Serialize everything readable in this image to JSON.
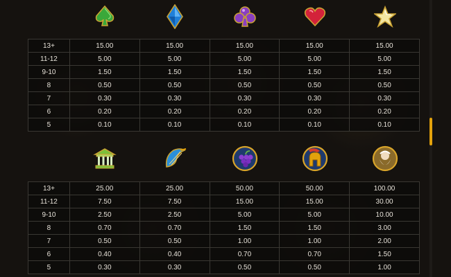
{
  "paytable": {
    "top": {
      "symbols": [
        "green-spade-gem",
        "blue-diamond-gem",
        "purple-club-gem",
        "red-heart-gem",
        "yellow-star-gem"
      ],
      "rows": [
        {
          "count": "13+",
          "values": [
            "15.00",
            "15.00",
            "15.00",
            "15.00",
            "15.00"
          ]
        },
        {
          "count": "11-12",
          "values": [
            "5.00",
            "5.00",
            "5.00",
            "5.00",
            "5.00"
          ]
        },
        {
          "count": "9-10",
          "values": [
            "1.50",
            "1.50",
            "1.50",
            "1.50",
            "1.50"
          ]
        },
        {
          "count": "8",
          "values": [
            "0.50",
            "0.50",
            "0.50",
            "0.50",
            "0.50"
          ]
        },
        {
          "count": "7",
          "values": [
            "0.30",
            "0.30",
            "0.30",
            "0.30",
            "0.30"
          ]
        },
        {
          "count": "6",
          "values": [
            "0.20",
            "0.20",
            "0.20",
            "0.20",
            "0.20"
          ]
        },
        {
          "count": "5",
          "values": [
            "0.10",
            "0.10",
            "0.10",
            "0.10",
            "0.10"
          ]
        }
      ]
    },
    "bottom": {
      "symbols": [
        "temple-icon",
        "harp-icon",
        "grapes-icon",
        "spartan-helmet-icon",
        "zeus-icon"
      ],
      "rows": [
        {
          "count": "13+",
          "values": [
            "25.00",
            "25.00",
            "50.00",
            "50.00",
            "100.00"
          ]
        },
        {
          "count": "11-12",
          "values": [
            "7.50",
            "7.50",
            "15.00",
            "15.00",
            "30.00"
          ]
        },
        {
          "count": "9-10",
          "values": [
            "2.50",
            "2.50",
            "5.00",
            "5.00",
            "10.00"
          ]
        },
        {
          "count": "8",
          "values": [
            "0.70",
            "0.70",
            "1.50",
            "1.50",
            "3.00"
          ]
        },
        {
          "count": "7",
          "values": [
            "0.50",
            "0.50",
            "1.00",
            "1.00",
            "2.00"
          ]
        },
        {
          "count": "6",
          "values": [
            "0.40",
            "0.40",
            "0.70",
            "0.70",
            "1.50"
          ]
        },
        {
          "count": "5",
          "values": [
            "0.30",
            "0.30",
            "0.50",
            "0.50",
            "1.00"
          ]
        }
      ]
    }
  },
  "colors": {
    "scrollbar_accent": "#e3a20c",
    "table_border": "#3a3833",
    "text": "#e6e1d8"
  }
}
